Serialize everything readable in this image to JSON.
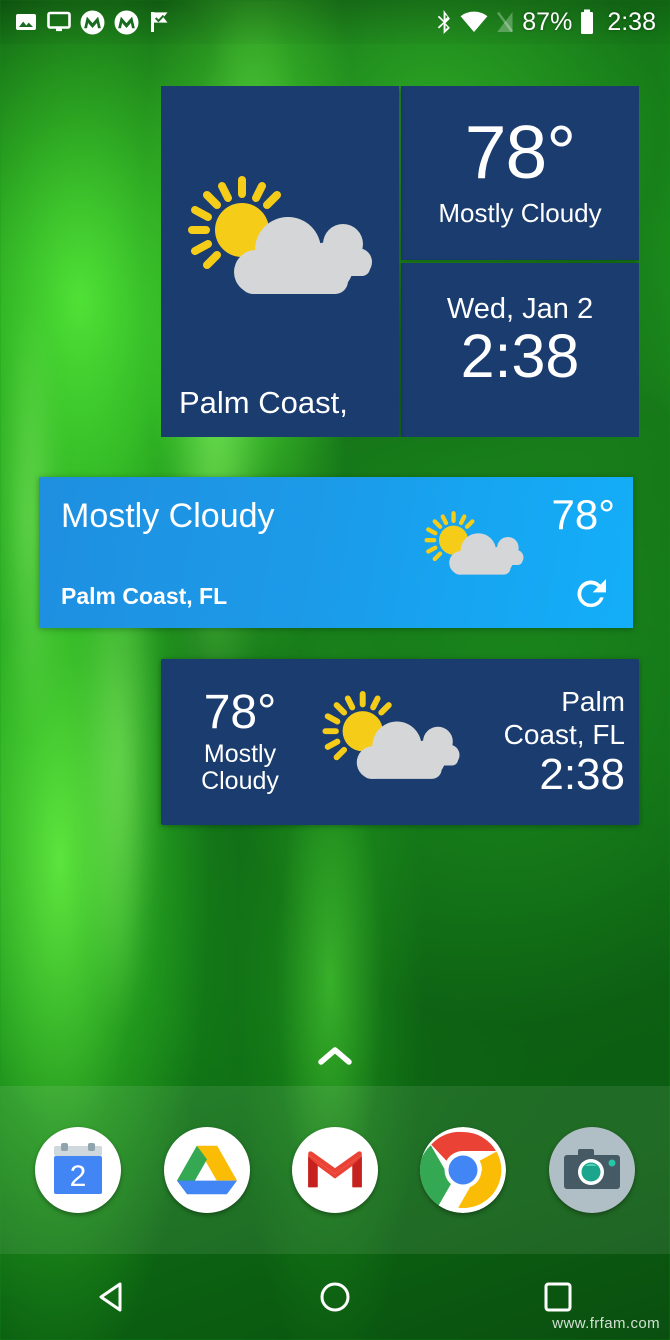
{
  "status_bar": {
    "left_icons": [
      {
        "name": "screenshot-image-icon",
        "label": "image"
      },
      {
        "name": "cast-screen-icon",
        "label": "cast"
      },
      {
        "name": "motorola-logo-icon",
        "label": "Motorola"
      },
      {
        "name": "motorola-logo-icon-2",
        "label": "Motorola"
      },
      {
        "name": "check-flag-icon",
        "label": "task"
      }
    ],
    "bluetooth_label": "Bluetooth",
    "wifi_label": "Wi-Fi",
    "signal_label": "No SIM",
    "battery_percent": "87%",
    "time": "2:38"
  },
  "weather_widget_large": {
    "city": "Palm Coast,",
    "temperature": "78°",
    "condition": "Mostly Cloudy",
    "date": "Wed, Jan 2",
    "time": "2:38",
    "icon": "sun-behind-cloud-icon",
    "background_color": "#1a3c6e"
  },
  "weather_widget_banner": {
    "condition": "Mostly Cloudy",
    "city": "Palm Coast, FL",
    "temperature": "78°",
    "icon": "sun-behind-cloud-icon",
    "refresh_icon": "refresh-icon",
    "background_color": "#16a6f2"
  },
  "weather_widget_wide": {
    "temperature": "78°",
    "condition_line1": "Mostly",
    "condition_line2": "Cloudy",
    "city_line1": "Palm",
    "city_line2": "Coast, FL",
    "time": "2:38",
    "icon": "sun-behind-cloud-icon",
    "background_color": "#1a3c6e"
  },
  "app_drawer": {
    "handle_icon": "chevron-up-icon"
  },
  "dock": {
    "apps": [
      {
        "name": "calendar",
        "label": "Calendar",
        "badge_day": "2"
      },
      {
        "name": "drive",
        "label": "Drive"
      },
      {
        "name": "gmail",
        "label": "Gmail"
      },
      {
        "name": "chrome",
        "label": "Chrome"
      },
      {
        "name": "camera",
        "label": "Camera"
      }
    ]
  },
  "navigation_bar": {
    "back_label": "Back",
    "home_label": "Home",
    "recents_label": "Recent apps"
  },
  "watermark": "www.frfam.com",
  "colors": {
    "widget_navy": "#1a3c6e",
    "banner_blue": "#16a6f2",
    "wallpaper_green": "#18901a",
    "sun_yellow": "#f5cd19",
    "cloud_grey": "#d5d6d8"
  }
}
